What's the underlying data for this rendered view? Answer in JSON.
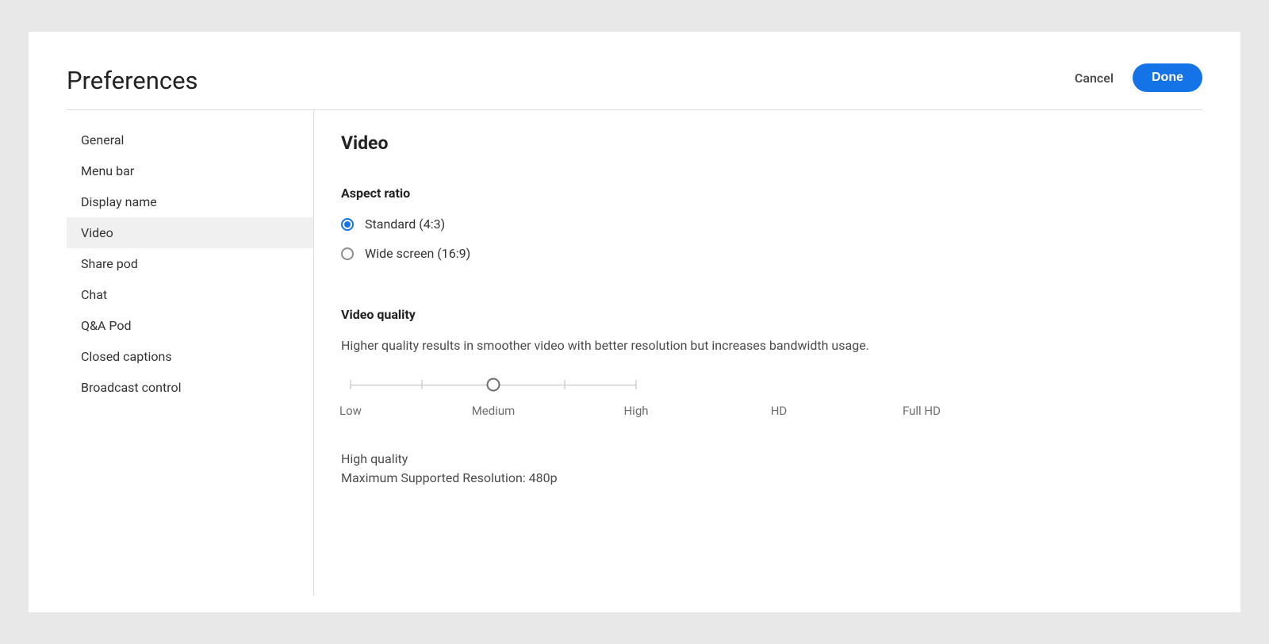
{
  "header": {
    "title": "Preferences",
    "cancel": "Cancel",
    "done": "Done"
  },
  "sidebar": {
    "items": [
      {
        "label": "General",
        "active": false
      },
      {
        "label": "Menu bar",
        "active": false
      },
      {
        "label": "Display name",
        "active": false
      },
      {
        "label": "Video",
        "active": true
      },
      {
        "label": "Share pod",
        "active": false
      },
      {
        "label": "Chat",
        "active": false
      },
      {
        "label": "Q&A Pod",
        "active": false
      },
      {
        "label": "Closed captions",
        "active": false
      },
      {
        "label": "Broadcast control",
        "active": false
      }
    ]
  },
  "content": {
    "heading": "Video",
    "aspectRatio": {
      "label": "Aspect ratio",
      "options": [
        {
          "label": "Standard (4:3)",
          "selected": true
        },
        {
          "label": "Wide screen (16:9)",
          "selected": false
        }
      ]
    },
    "videoQuality": {
      "label": "Video quality",
      "helper": "Higher quality results in smoother video with better resolution but increases bandwidth usage.",
      "steps": [
        "Low",
        "Medium",
        "High",
        "HD",
        "Full HD"
      ],
      "selectedIndex": 2,
      "statusLine1": "High quality",
      "statusLine2": "Maximum Supported Resolution: 480p"
    }
  }
}
